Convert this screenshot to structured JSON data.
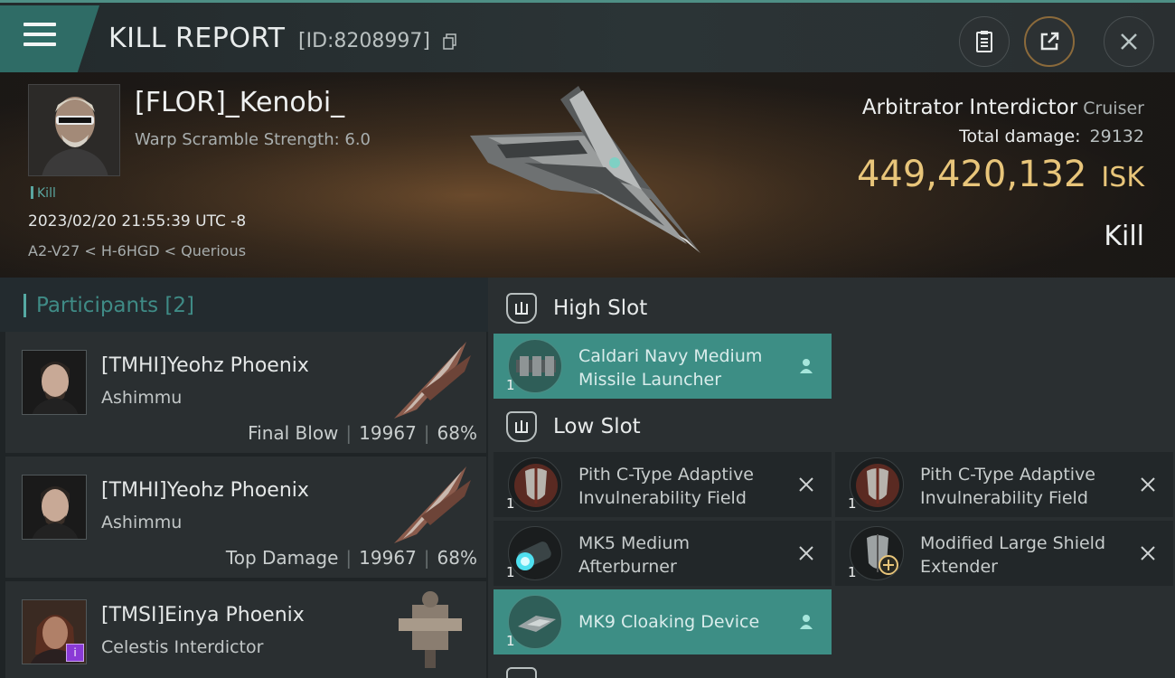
{
  "header": {
    "title": "KILL REPORT",
    "report_id": "[ID:8208997]"
  },
  "victim": {
    "name": "[FLOR]_Kenobi_",
    "warp_scramble": "Warp Scramble Strength: 6.0",
    "tag": "Kill",
    "datetime": "2023/02/20 21:55:39 UTC -8",
    "location": "A2-V27 < H-6HGD < Querious",
    "ship_name": "Arbitrator Interdictor",
    "ship_class": "Cruiser",
    "total_damage_label": "Total damage:",
    "total_damage": "29132",
    "isk_value": "449,420,132",
    "isk_unit": "ISK",
    "result": "Kill"
  },
  "participants": {
    "title": "Participants",
    "count": "[2]",
    "items": [
      {
        "name": "[TMHI]Yeohz Phoenix",
        "ship": "Ashimmu",
        "role": "Final Blow",
        "damage": "19967",
        "percent": "68%"
      },
      {
        "name": "[TMHI]Yeohz Phoenix",
        "ship": "Ashimmu",
        "role": "Top Damage",
        "damage": "19967",
        "percent": "68%"
      },
      {
        "name": "[TMSI]Einya Phoenix",
        "ship": "Celestis Interdictor",
        "badge": "i"
      }
    ]
  },
  "fitting": {
    "high_slot": {
      "label": "High Slot",
      "modules": [
        {
          "name": "Caldari Navy Medium Missile Launcher",
          "qty": "1",
          "status": "dropped"
        }
      ]
    },
    "low_slot": {
      "label": "Low Slot",
      "modules": [
        {
          "name": "Pith C-Type Adaptive Invulnerability Field",
          "qty": "1",
          "status": "destroyed"
        },
        {
          "name": "Pith C-Type Adaptive Invulnerability Field",
          "qty": "1",
          "status": "destroyed"
        },
        {
          "name": "MK5 Medium Afterburner",
          "qty": "1",
          "status": "destroyed"
        },
        {
          "name": "Modified Large Shield Extender",
          "qty": "1",
          "status": "destroyed"
        },
        {
          "name": "MK9 Cloaking Device",
          "qty": "1",
          "status": "dropped"
        }
      ]
    }
  },
  "colors": {
    "accent_teal": "#3d8e85",
    "isk_gold": "#e8c57a",
    "participants_teal": "#3f8b86"
  }
}
